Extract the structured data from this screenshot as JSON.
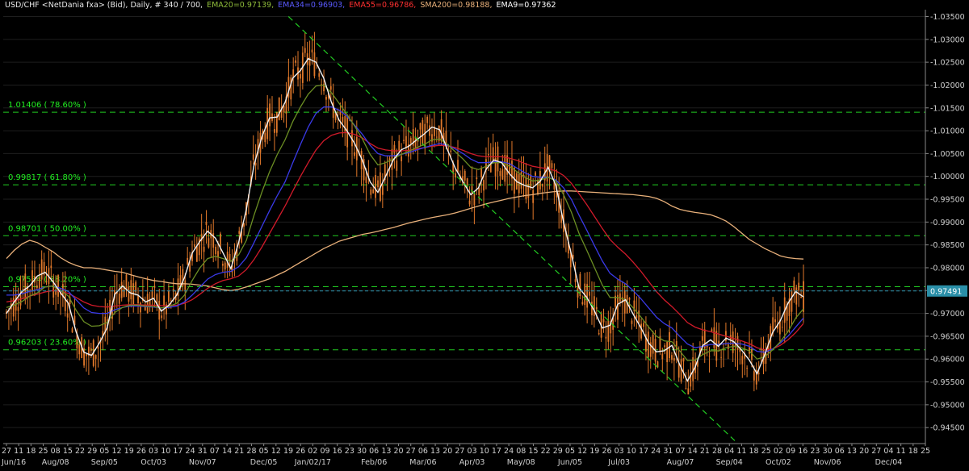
{
  "header": {
    "symbol": "USD/CHF <NetDania fxa> (Bid), Daily, # 340 / 700,",
    "ema20": "EMA20=0.97139,",
    "ema34": "EMA34=0.96903,",
    "ema55": "EMA55=0.96786,",
    "sma200": "SMA200=0.98188,",
    "ema9": "EMA9=0.97362"
  },
  "colors": {
    "background": "#000000",
    "candles": "#e0782a",
    "ema9": "#f0f0f0",
    "ema20": "#6b8e23",
    "ema34": "#3a3ae8",
    "ema55": "#d01a2a",
    "sma200": "#e8b07a",
    "fib": "#22cc22",
    "trend": "#22cc22",
    "price_box": "#2a8fa8"
  },
  "chart_data": {
    "type": "line",
    "ylim": [
      0.9415,
      1.0365
    ],
    "y_ticks": [
      "1.03500",
      "1.03000",
      "1.02500",
      "1.02000",
      "1.01500",
      "1.01000",
      "1.00500",
      "1.00000",
      "0.99500",
      "0.99000",
      "0.98500",
      "0.98000",
      "0.97500",
      "0.97000",
      "0.96500",
      "0.96000",
      "0.95500",
      "0.95000",
      "0.94500"
    ],
    "y_tick_values": [
      1.035,
      1.03,
      1.025,
      1.02,
      1.015,
      1.01,
      1.005,
      1.0,
      0.995,
      0.99,
      0.985,
      0.98,
      0.975,
      0.97,
      0.965,
      0.96,
      0.955,
      0.95,
      0.945
    ],
    "x_ticks": [
      "27",
      "11",
      "18",
      "25",
      "08",
      "15",
      "22",
      "29",
      "05",
      "12",
      "19",
      "26",
      "03",
      "10",
      "17",
      "24",
      "31",
      "07",
      "14",
      "21",
      "28",
      "05",
      "12",
      "19",
      "26",
      "02",
      "09",
      "16",
      "23",
      "30",
      "06",
      "13",
      "20",
      "27",
      "06",
      "13",
      "20",
      "27",
      "03",
      "10",
      "17",
      "24",
      "08",
      "15",
      "22",
      "29",
      "05",
      "12",
      "19",
      "26",
      "03",
      "10",
      "17",
      "24",
      "31",
      "07",
      "14",
      "21",
      "28",
      "04",
      "11",
      "18",
      "25",
      "02",
      "09",
      "16",
      "23",
      "30",
      "06",
      "13",
      "20",
      "27",
      "04",
      "11",
      "18",
      "25"
    ],
    "x_month_labels": [
      "Jun/16",
      "Aug/08",
      "Sep/05",
      "Oct/03",
      "Nov/07",
      "Dec/05",
      "Jan/02/17",
      "Feb/06",
      "Mar/06",
      "Apr/03",
      "May/08",
      "Jun/05",
      "Jul/03",
      "Aug/07",
      "Sep/04",
      "Oct/02",
      "Nov/06",
      "Dec/04"
    ],
    "fib_levels": [
      {
        "value": 1.01406,
        "label": "1.01406 ( 78.60% )"
      },
      {
        "value": 0.99817,
        "label": "0.99817 ( 61.80% )"
      },
      {
        "value": 0.98701,
        "label": "0.98701 ( 50.00% )"
      },
      {
        "value": 0.97584,
        "label": "0.97584 ( 38.20% )"
      },
      {
        "value": 0.96203,
        "label": "0.96203 ( 23.60% )"
      }
    ],
    "current_price": {
      "value": 0.97491,
      "label": "0.97491"
    },
    "series": [
      {
        "name": "EMA9",
        "values": [
          0.97,
          0.9725,
          0.9748,
          0.976,
          0.9782,
          0.979,
          0.977,
          0.9745,
          0.9722,
          0.966,
          0.9615,
          0.9608,
          0.9635,
          0.9668,
          0.9742,
          0.976,
          0.9745,
          0.974,
          0.9725,
          0.9733,
          0.9705,
          0.9718,
          0.974,
          0.9778,
          0.9832,
          0.9858,
          0.988,
          0.9865,
          0.9832,
          0.9798,
          0.9855,
          0.9928,
          1.0025,
          1.0086,
          1.0128,
          1.013,
          1.0162,
          1.0215,
          1.0232,
          1.0258,
          1.025,
          1.0215,
          1.0162,
          1.0123,
          1.01,
          1.0072,
          1.0035,
          0.9988,
          0.9965,
          1.0,
          1.0036,
          1.0058,
          1.0066,
          1.008,
          1.0093,
          1.0108,
          1.0102,
          1.0058,
          1.0018,
          0.9988,
          0.996,
          0.9975,
          1.0016,
          1.0036,
          1.003,
          1.0006,
          0.9988,
          0.998,
          0.9975,
          0.999,
          1.002,
          0.998,
          0.99,
          0.983,
          0.9756,
          0.9735,
          0.9705,
          0.9668,
          0.9674,
          0.972,
          0.973,
          0.9698,
          0.9668,
          0.9635,
          0.9616,
          0.9618,
          0.963,
          0.9588,
          0.9552,
          0.9582,
          0.963,
          0.9642,
          0.9628,
          0.9646,
          0.9638,
          0.962,
          0.9598,
          0.9568,
          0.961,
          0.9658,
          0.9684,
          0.9722,
          0.9748,
          0.9736
        ]
      },
      {
        "name": "EMA20",
        "values": [
          0.9713,
          0.9718,
          0.9726,
          0.9738,
          0.9745,
          0.9758,
          0.976,
          0.975,
          0.9738,
          0.9707,
          0.9682,
          0.9672,
          0.9673,
          0.968,
          0.9702,
          0.9713,
          0.9718,
          0.9718,
          0.9716,
          0.9715,
          0.9712,
          0.9715,
          0.9722,
          0.974,
          0.9772,
          0.98,
          0.982,
          0.9825,
          0.982,
          0.9814,
          0.9828,
          0.986,
          0.9915,
          0.9965,
          1.001,
          1.0048,
          1.008,
          1.012,
          1.0152,
          1.018,
          1.0198,
          1.02,
          1.0183,
          1.016,
          1.0136,
          1.011,
          1.0082,
          1.0048,
          1.0025,
          1.003,
          1.0038,
          1.0048,
          1.0055,
          1.0063,
          1.007,
          1.008,
          1.0082,
          1.007,
          1.0054,
          1.0038,
          1.002,
          1.0015,
          1.0022,
          1.003,
          1.003,
          1.0022,
          1.001,
          0.9998,
          0.999,
          0.9992,
          0.9998,
          0.999,
          0.996,
          0.9922,
          0.9875,
          0.9838,
          0.98,
          0.9762,
          0.9735,
          0.9735,
          0.973,
          0.9712,
          0.9692,
          0.967,
          0.965,
          0.964,
          0.9638,
          0.9618,
          0.9597,
          0.9598,
          0.961,
          0.9618,
          0.9618,
          0.9625,
          0.9628,
          0.9625,
          0.9618,
          0.96,
          0.9605,
          0.962,
          0.9638,
          0.966,
          0.969,
          0.971
        ]
      },
      {
        "name": "EMA34",
        "values": [
          0.974,
          0.974,
          0.9743,
          0.9748,
          0.9752,
          0.9758,
          0.976,
          0.9755,
          0.9748,
          0.973,
          0.9712,
          0.9702,
          0.97,
          0.97,
          0.9708,
          0.9713,
          0.9716,
          0.9716,
          0.9715,
          0.9714,
          0.9712,
          0.9713,
          0.9716,
          0.9725,
          0.974,
          0.9758,
          0.9775,
          0.9785,
          0.979,
          0.9792,
          0.9802,
          0.9822,
          0.9855,
          0.989,
          0.9925,
          0.9958,
          0.9988,
          1.003,
          1.007,
          1.0108,
          1.0138,
          1.0152,
          1.0152,
          1.0145,
          1.0132,
          1.0112,
          1.0092,
          1.0068,
          1.005,
          1.0045,
          1.0045,
          1.0048,
          1.0052,
          1.0058,
          1.0063,
          1.0068,
          1.0072,
          1.0068,
          1.006,
          1.005,
          1.0038,
          1.003,
          1.003,
          1.0032,
          1.0032,
          1.0028,
          1.0018,
          1.0008,
          1.0,
          0.9998,
          0.9998,
          0.9992,
          0.9975,
          0.995,
          0.9915,
          0.9882,
          0.9848,
          0.9815,
          0.9788,
          0.9775,
          0.9765,
          0.975,
          0.9732,
          0.9712,
          0.9692,
          0.9678,
          0.9668,
          0.965,
          0.9633,
          0.9625,
          0.9628,
          0.9632,
          0.9632,
          0.9634,
          0.9635,
          0.9633,
          0.9628,
          0.9617,
          0.9615,
          0.9622,
          0.9635,
          0.965,
          0.967,
          0.969
        ]
      },
      {
        "name": "EMA55",
        "values": [
          0.9725,
          0.9728,
          0.9732,
          0.9738,
          0.9742,
          0.9747,
          0.975,
          0.9748,
          0.9744,
          0.9735,
          0.9725,
          0.9718,
          0.9715,
          0.9714,
          0.9716,
          0.9718,
          0.9719,
          0.9719,
          0.9718,
          0.9718,
          0.9717,
          0.9717,
          0.9718,
          0.9722,
          0.973,
          0.9742,
          0.9755,
          0.9765,
          0.9772,
          0.9776,
          0.9782,
          0.9796,
          0.9818,
          0.9845,
          0.9875,
          0.9905,
          0.9935,
          0.9968,
          1.0,
          1.003,
          1.0058,
          1.0078,
          1.009,
          1.0095,
          1.0096,
          1.0092,
          1.0084,
          1.0072,
          1.0062,
          1.0058,
          1.0056,
          1.0056,
          1.0057,
          1.006,
          1.0063,
          1.0066,
          1.0068,
          1.0067,
          1.0063,
          1.0057,
          1.005,
          1.0045,
          1.0043,
          1.0043,
          1.0043,
          1.004,
          1.0035,
          1.0028,
          1.0022,
          1.0019,
          1.0017,
          1.0012,
          1.0002,
          0.9985,
          0.9962,
          0.9938,
          0.9912,
          0.9886,
          0.9862,
          0.9845,
          0.983,
          0.9812,
          0.9792,
          0.977,
          0.9748,
          0.973,
          0.9715,
          0.9698,
          0.968,
          0.967,
          0.9664,
          0.966,
          0.9655,
          0.965,
          0.9645,
          0.964,
          0.9634,
          0.9625,
          0.962,
          0.9622,
          0.963,
          0.9642,
          0.9658,
          0.9678
        ]
      },
      {
        "name": "SMA200",
        "values": [
          0.982,
          0.9838,
          0.9852,
          0.986,
          0.9855,
          0.9845,
          0.9835,
          0.9822,
          0.9812,
          0.9805,
          0.98,
          0.98,
          0.9798,
          0.9795,
          0.9792,
          0.979,
          0.9785,
          0.978,
          0.9776,
          0.9772,
          0.977,
          0.9767,
          0.9765,
          0.9765,
          0.9764,
          0.9762,
          0.976,
          0.9756,
          0.9752,
          0.975,
          0.9753,
          0.9758,
          0.9764,
          0.977,
          0.9776,
          0.9784,
          0.9792,
          0.9802,
          0.9812,
          0.9822,
          0.9832,
          0.9842,
          0.985,
          0.9858,
          0.9863,
          0.9868,
          0.9873,
          0.9876,
          0.988,
          0.9884,
          0.9888,
          0.9893,
          0.9898,
          0.9902,
          0.9906,
          0.991,
          0.9913,
          0.9916,
          0.992,
          0.9925,
          0.993,
          0.9935,
          0.994,
          0.9944,
          0.9948,
          0.9952,
          0.9955,
          0.9958,
          0.996,
          0.9963,
          0.9965,
          0.9967,
          0.9968,
          0.9968,
          0.9967,
          0.9966,
          0.9965,
          0.9964,
          0.9963,
          0.9962,
          0.9961,
          0.996,
          0.9958,
          0.9956,
          0.9952,
          0.9945,
          0.9935,
          0.9928,
          0.9924,
          0.9921,
          0.9919,
          0.9916,
          0.991,
          0.9902,
          0.989,
          0.9876,
          0.9862,
          0.9852,
          0.9842,
          0.9834,
          0.9826,
          0.9822,
          0.982,
          0.9819
        ]
      }
    ],
    "trendlines": [
      {
        "x0": 0.3093,
        "y0": 1.035,
        "x1": 0.7966,
        "y1": 0.9415
      }
    ]
  }
}
